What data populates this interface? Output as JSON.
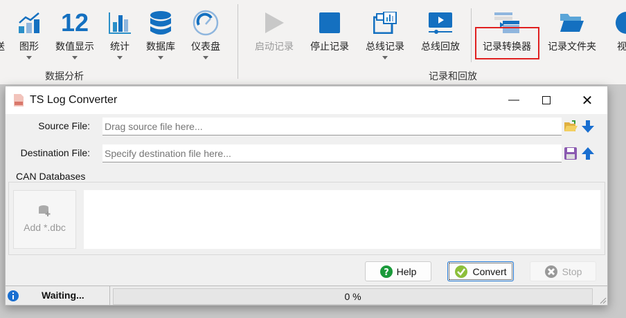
{
  "ribbon": {
    "partial_left": "送",
    "items": [
      {
        "label": "图形",
        "icon": "line-chart-icon",
        "dropdown": true
      },
      {
        "label": "数值显示",
        "icon": "numeric-display-icon",
        "glyph": "12",
        "dropdown": true
      },
      {
        "label": "统计",
        "icon": "bar-chart-icon",
        "dropdown": true
      },
      {
        "label": "数据库",
        "icon": "database-icon",
        "dropdown": true
      },
      {
        "label": "仪表盘",
        "icon": "gauge-icon",
        "dropdown": true
      },
      {
        "label": "启动记录",
        "icon": "play-icon",
        "disabled": true
      },
      {
        "label": "停止记录",
        "icon": "stop-icon"
      },
      {
        "label": "总线记录",
        "icon": "bus-record-icon",
        "dropdown": true
      },
      {
        "label": "总线回放",
        "icon": "bus-replay-icon"
      },
      {
        "label": "记录转换器",
        "icon": "log-converter-icon",
        "highlighted": true
      },
      {
        "label": "记录文件夹",
        "icon": "folder-icon"
      },
      {
        "label": "视频",
        "icon": "video-icon"
      }
    ],
    "groups": [
      "数据分析",
      "记录和回放"
    ],
    "highlight_color": "#e02020",
    "accent": "#1470c0"
  },
  "dialog": {
    "title": "TS Log Converter",
    "source_label": "Source File:",
    "source_placeholder": "Drag source file here...",
    "dest_label": "Destination File:",
    "dest_placeholder": "Specify destination file here...",
    "databases_label": "CAN Databases",
    "add_dbc": "Add *.dbc",
    "help": "Help",
    "convert": "Convert",
    "stop": "Stop",
    "status": "Waiting...",
    "progress_text": "0 %",
    "progress": 0
  }
}
